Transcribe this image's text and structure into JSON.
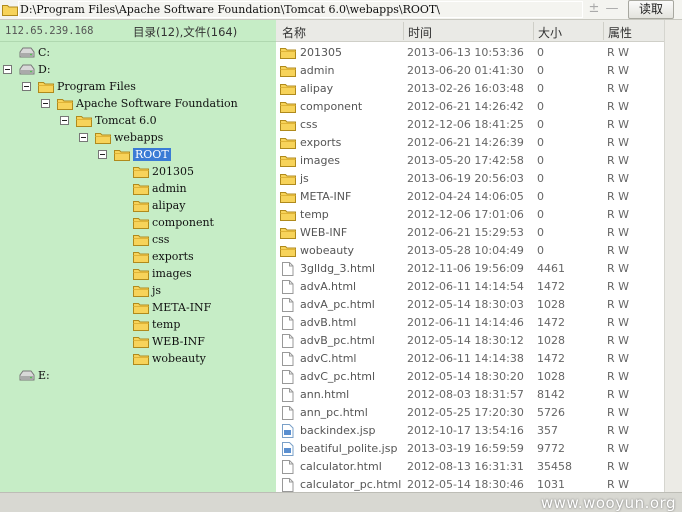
{
  "address": {
    "path": "D:\\Program Files\\Apache Software Foundation\\Tomcat 6.0\\webapps\\ROOT\\",
    "plus": "±",
    "minus": "—",
    "read_button": "读取"
  },
  "left_panel": {
    "ip": "112.65.239.168",
    "counts": "目录(12),文件(164)"
  },
  "tree": [
    {
      "label": "C:",
      "type": "drive"
    },
    {
      "label": "D:",
      "type": "drive"
    },
    {
      "label": "Program Files",
      "type": "folder"
    },
    {
      "label": "Apache Software Foundation",
      "type": "folder"
    },
    {
      "label": "Tomcat 6.0",
      "type": "folder"
    },
    {
      "label": "webapps",
      "type": "folder"
    },
    {
      "label": "ROOT",
      "type": "folder"
    },
    {
      "label": "201305",
      "type": "folder"
    },
    {
      "label": "admin",
      "type": "folder"
    },
    {
      "label": "alipay",
      "type": "folder"
    },
    {
      "label": "component",
      "type": "folder"
    },
    {
      "label": "css",
      "type": "folder"
    },
    {
      "label": "exports",
      "type": "folder"
    },
    {
      "label": "images",
      "type": "folder"
    },
    {
      "label": "js",
      "type": "folder"
    },
    {
      "label": "META-INF",
      "type": "folder"
    },
    {
      "label": "temp",
      "type": "folder"
    },
    {
      "label": "WEB-INF",
      "type": "folder"
    },
    {
      "label": "wobeauty",
      "type": "folder"
    },
    {
      "label": "E:",
      "type": "drive"
    }
  ],
  "columns": {
    "name": "名称",
    "time": "时间",
    "size": "大小",
    "attr": "属性"
  },
  "files": [
    {
      "name": "201305",
      "time": "2013-06-13 10:53:36",
      "size": "0",
      "attr": "R W",
      "kind": "folder"
    },
    {
      "name": "admin",
      "time": "2013-06-20 01:41:30",
      "size": "0",
      "attr": "R W",
      "kind": "folder"
    },
    {
      "name": "alipay",
      "time": "2013-02-26 16:03:48",
      "size": "0",
      "attr": "R W",
      "kind": "folder"
    },
    {
      "name": "component",
      "time": "2012-06-21 14:26:42",
      "size": "0",
      "attr": "R W",
      "kind": "folder"
    },
    {
      "name": "css",
      "time": "2012-12-06 18:41:25",
      "size": "0",
      "attr": "R W",
      "kind": "folder"
    },
    {
      "name": "exports",
      "time": "2012-06-21 14:26:39",
      "size": "0",
      "attr": "R W",
      "kind": "folder"
    },
    {
      "name": "images",
      "time": "2013-05-20 17:42:58",
      "size": "0",
      "attr": "R W",
      "kind": "folder"
    },
    {
      "name": "js",
      "time": "2013-06-19 20:56:03",
      "size": "0",
      "attr": "R W",
      "kind": "folder"
    },
    {
      "name": "META-INF",
      "time": "2012-04-24 14:06:05",
      "size": "0",
      "attr": "R W",
      "kind": "folder"
    },
    {
      "name": "temp",
      "time": "2012-12-06 17:01:06",
      "size": "0",
      "attr": "R W",
      "kind": "folder"
    },
    {
      "name": "WEB-INF",
      "time": "2012-06-21 15:29:53",
      "size": "0",
      "attr": "R W",
      "kind": "folder"
    },
    {
      "name": "wobeauty",
      "time": "2013-05-28 10:04:49",
      "size": "0",
      "attr": "R W",
      "kind": "folder"
    },
    {
      "name": "3glldg_3.html",
      "time": "2012-11-06 19:56:09",
      "size": "4461",
      "attr": "R W",
      "kind": "file"
    },
    {
      "name": "advA.html",
      "time": "2012-06-11 14:14:54",
      "size": "1472",
      "attr": "R W",
      "kind": "file"
    },
    {
      "name": "advA_pc.html",
      "time": "2012-05-14 18:30:03",
      "size": "1028",
      "attr": "R W",
      "kind": "file"
    },
    {
      "name": "advB.html",
      "time": "2012-06-11 14:14:46",
      "size": "1472",
      "attr": "R W",
      "kind": "file"
    },
    {
      "name": "advB_pc.html",
      "time": "2012-05-14 18:30:12",
      "size": "1028",
      "attr": "R W",
      "kind": "file"
    },
    {
      "name": "advC.html",
      "time": "2012-06-11 14:14:38",
      "size": "1472",
      "attr": "R W",
      "kind": "file"
    },
    {
      "name": "advC_pc.html",
      "time": "2012-05-14 18:30:20",
      "size": "1028",
      "attr": "R W",
      "kind": "file"
    },
    {
      "name": "ann.html",
      "time": "2012-08-03 18:31:57",
      "size": "8142",
      "attr": "R W",
      "kind": "file"
    },
    {
      "name": "ann_pc.html",
      "time": "2012-05-25 17:20:30",
      "size": "5726",
      "attr": "R W",
      "kind": "file"
    },
    {
      "name": "backindex.jsp",
      "time": "2012-10-17 13:54:16",
      "size": "357",
      "attr": "R W",
      "kind": "jsp"
    },
    {
      "name": "beatiful_polite.jsp",
      "time": "2013-03-19 16:59:59",
      "size": "9772",
      "attr": "R W",
      "kind": "jsp"
    },
    {
      "name": "calculator.html",
      "time": "2012-08-13 16:31:31",
      "size": "35458",
      "attr": "R W",
      "kind": "file"
    },
    {
      "name": "calculator_pc.html",
      "time": "2012-05-14 18:30:46",
      "size": "1031",
      "attr": "R W",
      "kind": "file"
    }
  ],
  "watermark": "www.wooyun.org"
}
